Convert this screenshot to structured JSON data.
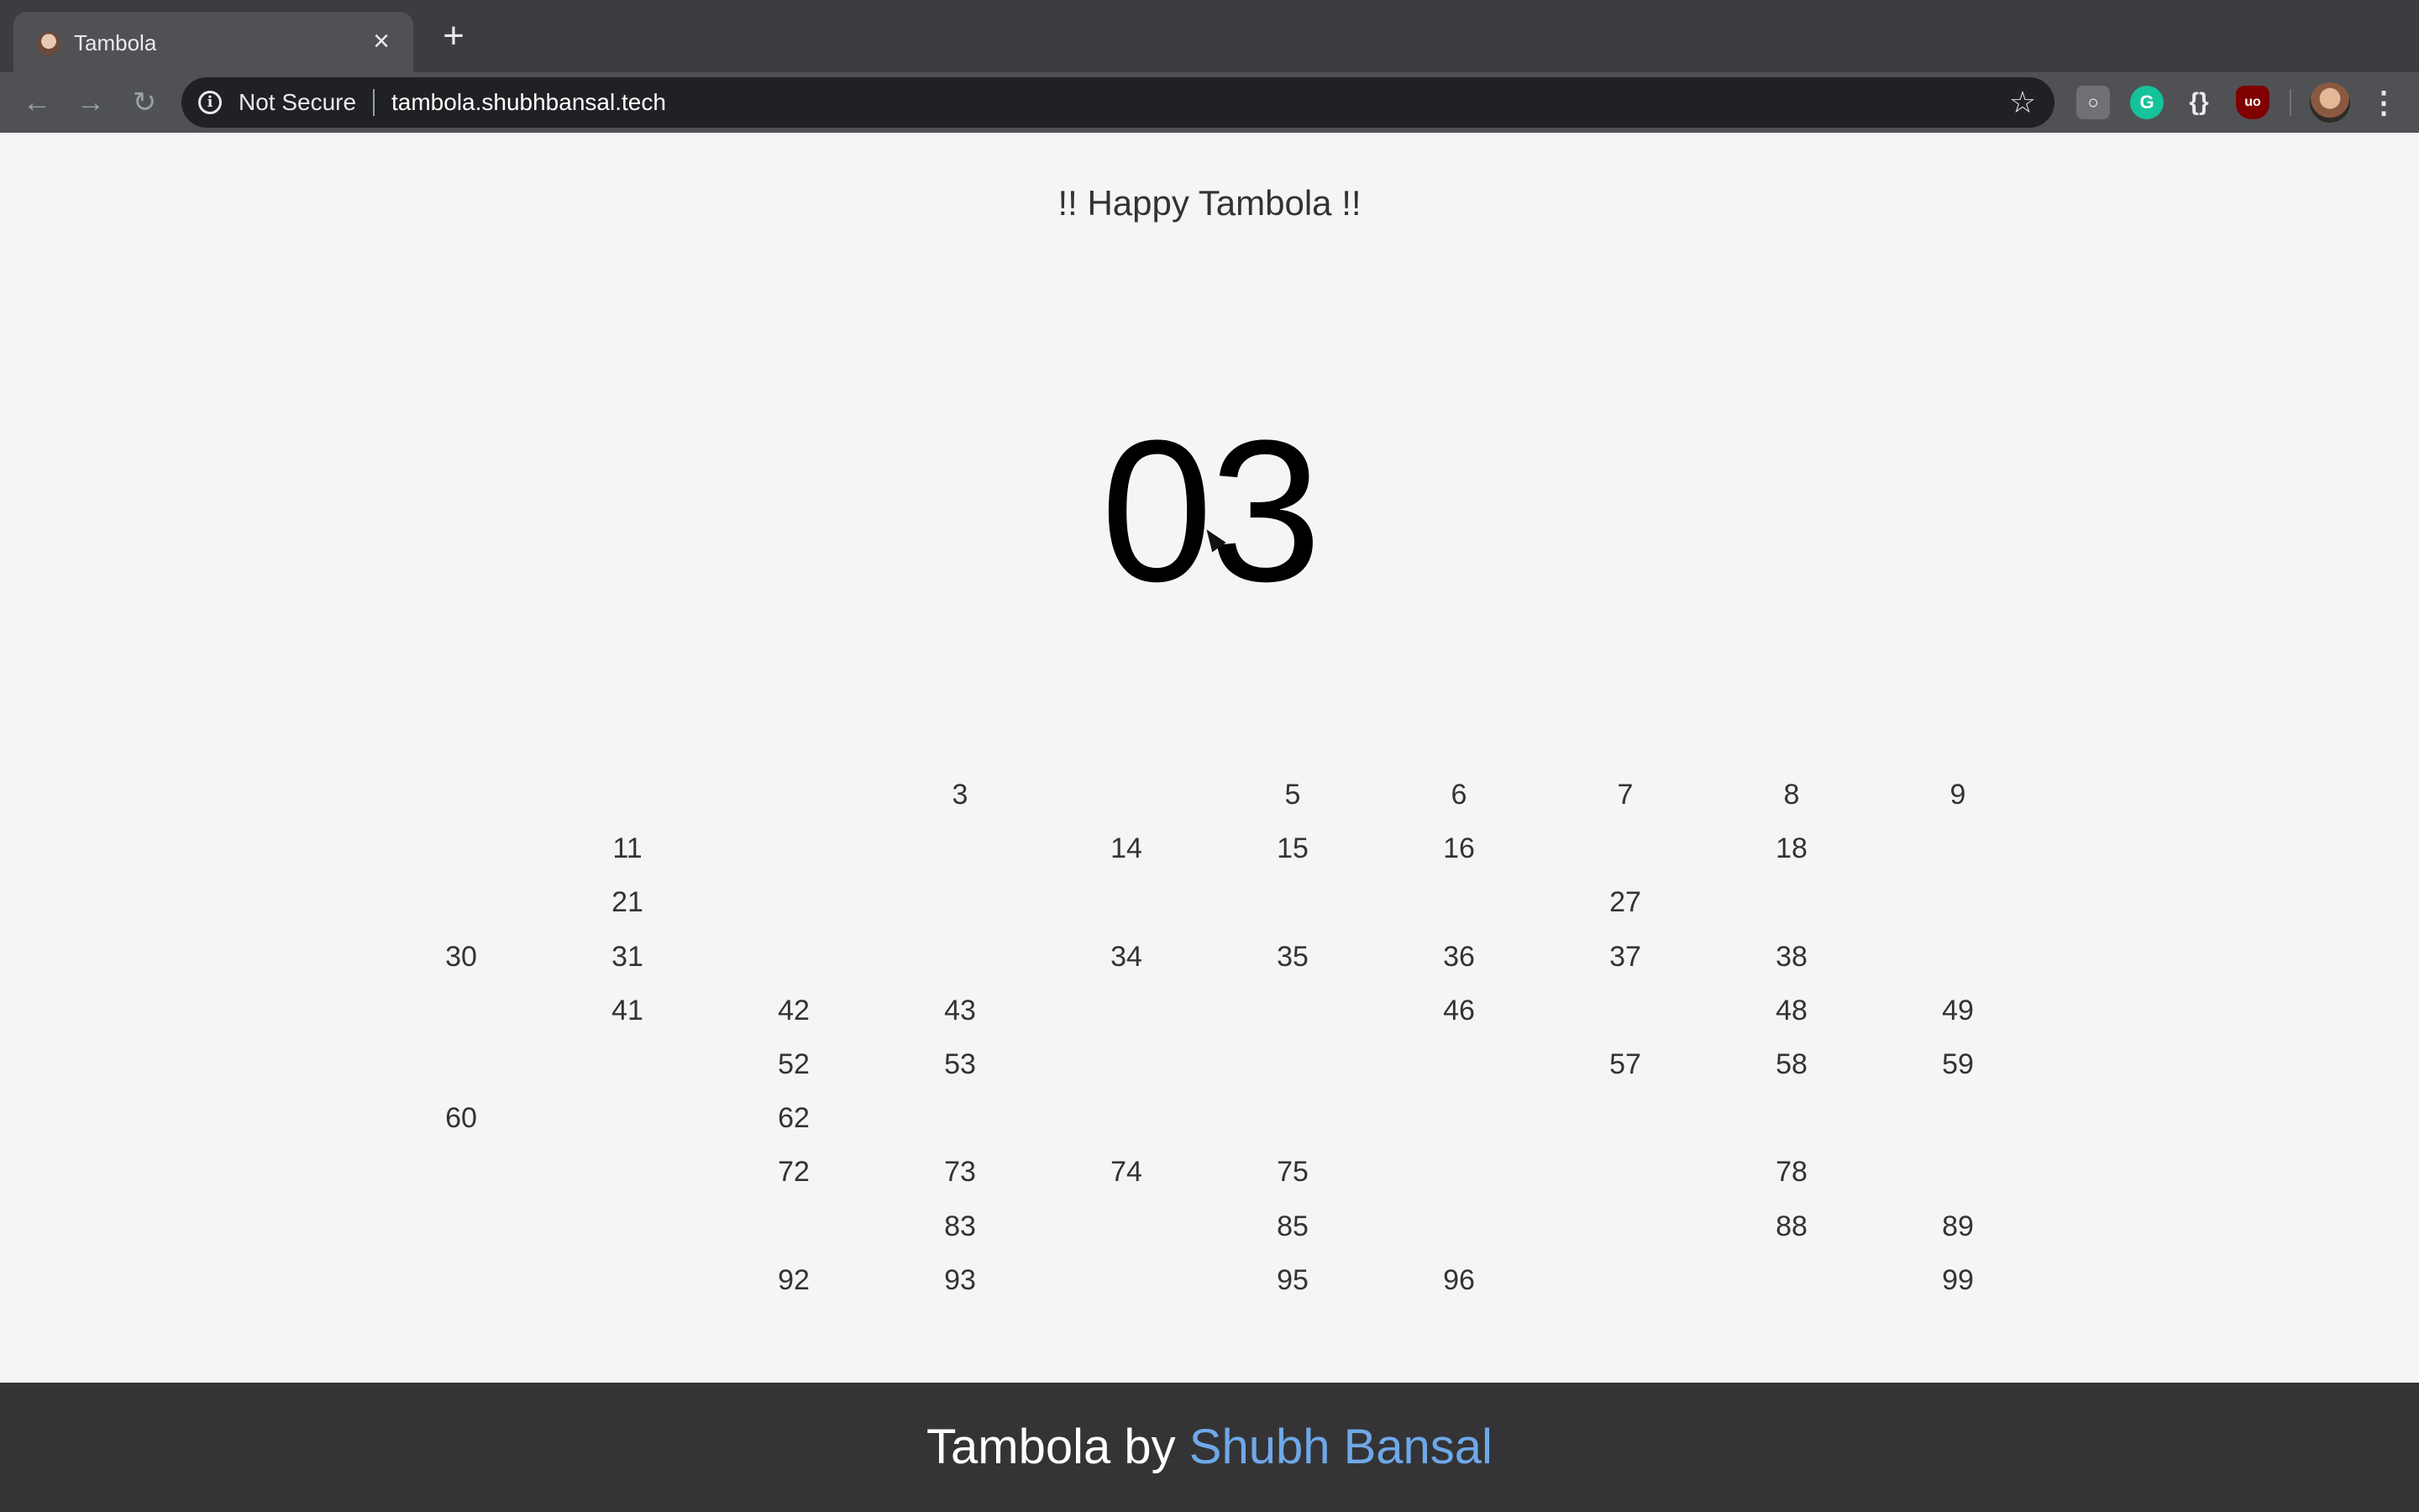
{
  "browser": {
    "tab_title": "Tambola",
    "tab_close": "×",
    "new_tab": "+",
    "security_label": "Not Secure",
    "url": "tambola.shubhbansal.tech"
  },
  "page": {
    "heading": "!! Happy Tambola !!",
    "current_number": "03"
  },
  "board": {
    "rows": [
      [
        "",
        "",
        "",
        "3",
        "",
        "5",
        "6",
        "7",
        "8",
        "9"
      ],
      [
        "",
        "11",
        "",
        "",
        "14",
        "15",
        "16",
        "",
        "18",
        ""
      ],
      [
        "",
        "21",
        "",
        "",
        "",
        "",
        "",
        "27",
        "",
        ""
      ],
      [
        "30",
        "31",
        "",
        "",
        "34",
        "35",
        "36",
        "37",
        "38",
        ""
      ],
      [
        "",
        "41",
        "42",
        "43",
        "",
        "",
        "46",
        "",
        "48",
        "49"
      ],
      [
        "",
        "",
        "52",
        "53",
        "",
        "",
        "",
        "57",
        "58",
        "59"
      ],
      [
        "60",
        "",
        "62",
        "",
        "",
        "",
        "",
        "",
        "",
        ""
      ],
      [
        "",
        "",
        "72",
        "73",
        "74",
        "75",
        "",
        "",
        "78",
        ""
      ],
      [
        "",
        "",
        "",
        "83",
        "",
        "85",
        "",
        "",
        "88",
        "89"
      ],
      [
        "",
        "",
        "92",
        "93",
        "",
        "95",
        "96",
        "",
        "",
        "99"
      ]
    ]
  },
  "footer": {
    "prefix": "Tambola by ",
    "author": "Shubh Bansal"
  },
  "colors": {
    "page_background": "#f5f5f5",
    "footer_background": "#343436",
    "link": "#6fa8e8"
  }
}
